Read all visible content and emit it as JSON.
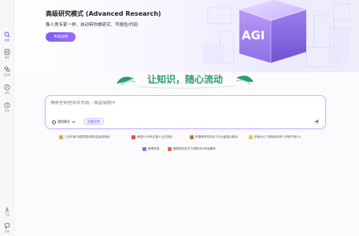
{
  "sidebar": {
    "items": [
      {
        "label": "搜索",
        "icon": "search-icon"
      },
      {
        "label": "报告",
        "icon": "report-icon"
      },
      {
        "label": "知识库",
        "icon": "knowledge-icon"
      },
      {
        "label": "发现",
        "icon": "discover-icon"
      },
      {
        "label": "历史",
        "icon": "history-icon"
      }
    ],
    "bottom": [
      {
        "label": "下载",
        "icon": "download-icon"
      },
      {
        "label": "反馈",
        "icon": "feedback-icon"
      }
    ]
  },
  "banner": {
    "title": "高级研究模式 (Advanced Research)",
    "subtitle": "像人类专家一样，自动带你做研究、写报告/代码",
    "apply_label": "申请试用",
    "art_text": "AGI"
  },
  "heading": {
    "text": "让知识，随心流动"
  },
  "search": {
    "placeholder": "搜索全网信息并总结，或直接提问",
    "model_label": "通用模式",
    "deep_label": "深度思考"
  },
  "suggestions": [
    {
      "label": "习近平和中国同国际博览会演讲致辞",
      "color": "#e0a24a"
    },
    {
      "label": "韩国2026年实施十五五规划",
      "color": "#e04a4a"
    },
    {
      "label": "苹果秋季发布会下已大量推出新品",
      "color": "#d0743a"
    },
    {
      "label": "多家大行下调存款利率 1年期下破1%",
      "color": "#e8c84a"
    },
    {
      "label": "微博热搜",
      "color": "#8a6ff0"
    },
    {
      "label": "最新国内形式下调质优升体验解体",
      "color": "#e06a4a"
    }
  ],
  "colors": {
    "accent": "#7a5cf6",
    "heading_green": "#2e9c6a"
  }
}
